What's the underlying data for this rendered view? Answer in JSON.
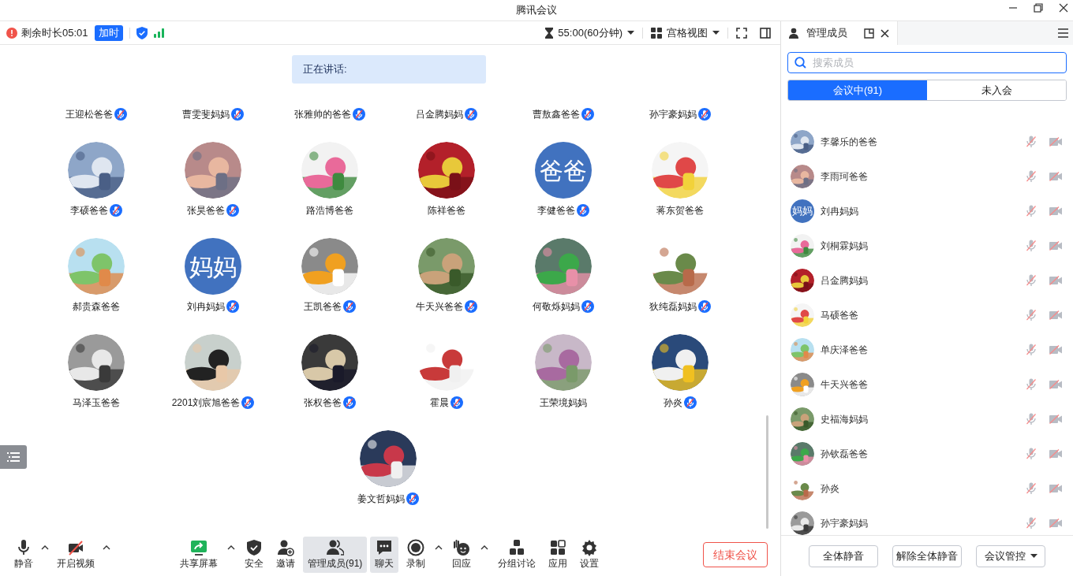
{
  "window": {
    "title": "腾讯会议"
  },
  "meeting_bar": {
    "remaining": "剩余时长05:01",
    "extend_button": "加时",
    "timer": "55:00(60分钟)",
    "view": "宫格视图"
  },
  "speaking": {
    "label": "正在讲话:"
  },
  "top_row": [
    {
      "name": "王迎松爸爸",
      "mic_badge": true
    },
    {
      "name": "曹雯斐妈妈",
      "mic_badge": true
    },
    {
      "name": "张雅帅的爸爸",
      "mic_badge": true
    },
    {
      "name": "吕金腾妈妈",
      "mic_badge": true
    },
    {
      "name": "曹敖鑫爸爸",
      "mic_badge": true
    },
    {
      "name": "孙宇豪妈妈",
      "mic_badge": true
    }
  ],
  "participants": [
    {
      "name": "李硕爸爸",
      "mic_badge": true
    },
    {
      "name": "张昊爸爸",
      "mic_badge": true
    },
    {
      "name": "路浩博爸爸",
      "mic_badge": false
    },
    {
      "name": "陈祥爸爸",
      "mic_badge": false
    },
    {
      "name": "李健爸爸",
      "mic_badge": true,
      "avatar": {
        "kind": "text",
        "text": "爸爸"
      }
    },
    {
      "name": "蒋东贺爸爸",
      "mic_badge": false
    },
    {
      "name": "郝贵森爸爸",
      "mic_badge": false
    },
    {
      "name": "刘冉妈妈",
      "mic_badge": true,
      "avatar": {
        "kind": "text",
        "text": "妈妈"
      }
    },
    {
      "name": "王凯爸爸",
      "mic_badge": true
    },
    {
      "name": "牛天兴爸爸",
      "mic_badge": true
    },
    {
      "name": "何敬烁妈妈",
      "mic_badge": true
    },
    {
      "name": "狄纯磊妈妈",
      "mic_badge": true
    },
    {
      "name": "马泽玉爸爸",
      "mic_badge": false
    },
    {
      "name": "2201刘宸旭爸爸",
      "mic_badge": true
    },
    {
      "name": "张权爸爸",
      "mic_badge": true
    },
    {
      "name": "霍晨",
      "mic_badge": true
    },
    {
      "name": "王荣境妈妈",
      "mic_badge": false
    },
    {
      "name": "孙炎",
      "mic_badge": true
    },
    {
      "name": "姜文哲妈妈",
      "mic_badge": true
    }
  ],
  "toolbar": [
    {
      "label": "静音",
      "caret": true,
      "selected": false
    },
    {
      "label": "开启视频",
      "caret": true,
      "selected": false
    },
    {
      "label": "共享屏幕",
      "caret": true,
      "selected": false
    },
    {
      "label": "安全",
      "caret": false,
      "selected": false
    },
    {
      "label": "邀请",
      "caret": false,
      "selected": false
    },
    {
      "label": "管理成员(91)",
      "caret": false,
      "selected": true
    },
    {
      "label": "聊天",
      "caret": false,
      "selected": true
    },
    {
      "label": "录制",
      "caret": true,
      "selected": false
    },
    {
      "label": "回应",
      "caret": true,
      "selected": false
    },
    {
      "label": "分组讨论",
      "caret": false,
      "selected": false
    },
    {
      "label": "应用",
      "caret": false,
      "selected": false
    },
    {
      "label": "设置",
      "caret": false,
      "selected": false
    }
  ],
  "end_button": "结束会议",
  "panel": {
    "title": "管理成员",
    "search": {
      "placeholder": "搜索成员"
    },
    "tabs": [
      {
        "label": "会议中(91)",
        "selected": true
      },
      {
        "label": "未入会",
        "selected": false
      }
    ],
    "members": [
      {
        "name": "李馨乐的爸爸",
        "muted": true,
        "camera_off": true
      },
      {
        "name": "李雨珂爸爸",
        "muted": true,
        "camera_off": true
      },
      {
        "name": "刘冉妈妈",
        "avatar": {
          "kind": "text",
          "text": "妈妈"
        },
        "muted": true,
        "camera_off": true
      },
      {
        "name": "刘桐霖妈妈",
        "muted": true,
        "camera_off": true
      },
      {
        "name": "吕金腾妈妈",
        "muted": true,
        "camera_off": true
      },
      {
        "name": "马硕爸爸",
        "muted": true,
        "camera_off": true
      },
      {
        "name": "单庆泽爸爸",
        "muted": true,
        "camera_off": true
      },
      {
        "name": "牛天兴爸爸",
        "muted": true,
        "camera_off": true
      },
      {
        "name": "史福海妈妈",
        "muted": true,
        "camera_off": true
      },
      {
        "name": "孙钦磊爸爸",
        "muted": true,
        "camera_off": true
      },
      {
        "name": "孙炎",
        "muted": true,
        "camera_off": true
      },
      {
        "name": "孙宇豪妈妈",
        "muted": true,
        "camera_off": true
      }
    ],
    "buttons": [
      {
        "label": "全体静音",
        "caret": false
      },
      {
        "label": "解除全体静音",
        "caret": false
      },
      {
        "label": "会议管控",
        "caret": true
      }
    ]
  }
}
